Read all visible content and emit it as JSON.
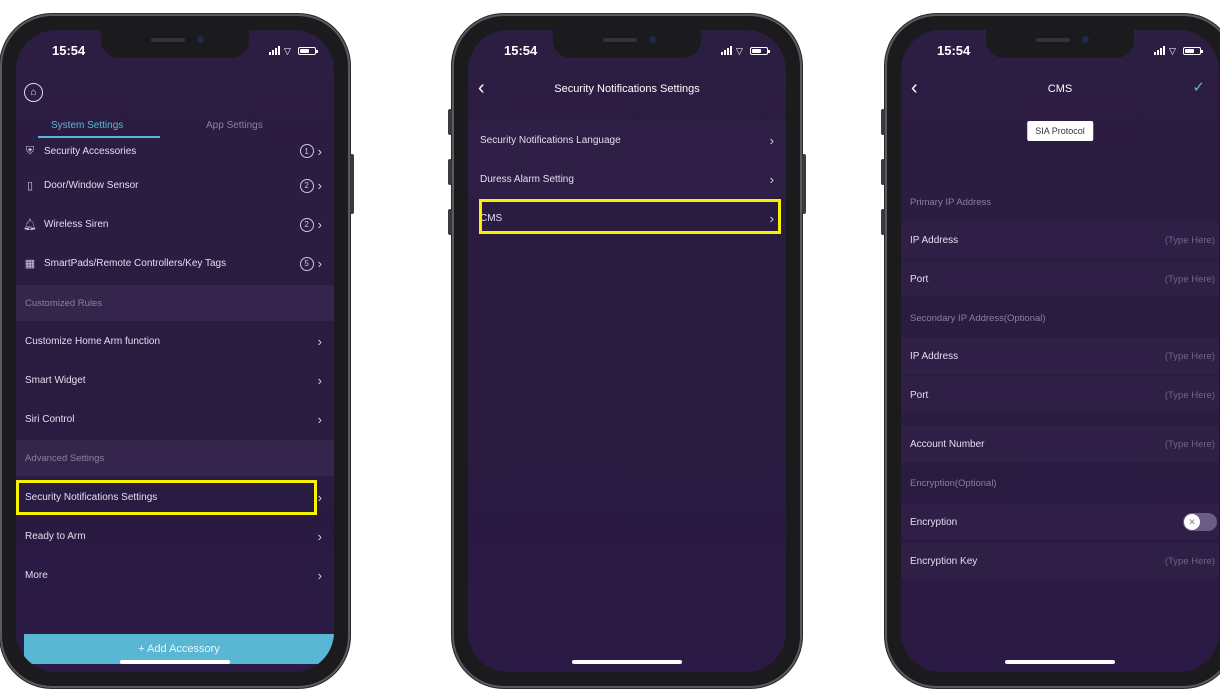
{
  "status_time": "15:54",
  "colors": {
    "accent": "#5bb7d5",
    "highlight": "#f6f200",
    "background": "#2c1d42"
  },
  "screen1": {
    "tabs": [
      "System Settings",
      "App Settings"
    ],
    "accessories": [
      {
        "label": "Security Accessories",
        "count": "1",
        "icon": "shield-icon"
      },
      {
        "label": "Door/Window Sensor",
        "count": "2",
        "icon": "door-sensor-icon"
      },
      {
        "label": "Wireless Siren",
        "count": "2",
        "icon": "bell-icon"
      },
      {
        "label": "SmartPads/Remote Controllers/Key Tags",
        "count": "5",
        "icon": "keypad-icon"
      }
    ],
    "section_customized": "Customized Rules",
    "customized_items": [
      "Customize Home Arm function",
      "Smart Widget",
      "Siri Control"
    ],
    "section_advanced": "Advanced Settings",
    "advanced_items": [
      "Security Notifications Settings",
      "Ready to Arm",
      "More"
    ],
    "add_button": "+  Add Accessory"
  },
  "screen2": {
    "title": "Security Notifications Settings",
    "items": [
      "Security Notifications Language",
      "Duress Alarm Setting",
      "CMS"
    ]
  },
  "screen3": {
    "title": "CMS",
    "protocol_chip": "SIA Protocol",
    "section_primary": "Primary IP Address",
    "section_secondary": "Secondary IP Address(Optional)",
    "section_encryption": "Encryption(Optional)",
    "field_ip": "IP Address",
    "field_port": "Port",
    "field_account": "Account Number",
    "field_encryption": "Encryption",
    "field_encryption_key": "Encryption Key",
    "placeholder": "(Type Here)",
    "encryption_enabled": false
  }
}
